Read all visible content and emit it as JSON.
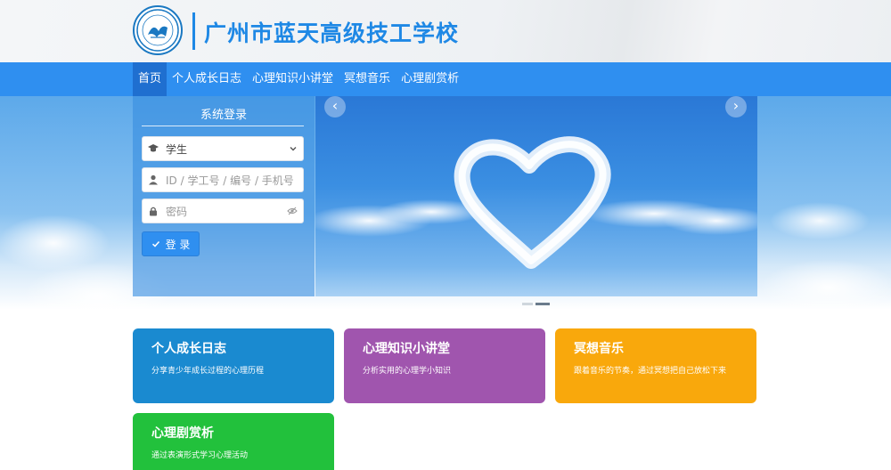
{
  "header": {
    "site_title": "广州市蓝天高级技工学校"
  },
  "nav": {
    "items": [
      {
        "label": "首页",
        "active": true
      },
      {
        "label": "个人成长日志",
        "active": false
      },
      {
        "label": "心理知识小讲堂",
        "active": false
      },
      {
        "label": "冥想音乐",
        "active": false
      },
      {
        "label": "心理剧赏析",
        "active": false
      }
    ]
  },
  "login": {
    "title": "系统登录",
    "role_value": "学生",
    "id_placeholder": "ID / 学工号 / 编号 / 手机号",
    "password_placeholder": "密码",
    "submit_label": "登 录"
  },
  "cards": [
    {
      "title": "个人成长日志",
      "desc": "分享青少年成长过程的心理历程",
      "color": "#1a8ad0"
    },
    {
      "title": "心理知识小讲堂",
      "desc": "分析实用的心理学小知识",
      "color": "#a055ae"
    },
    {
      "title": "冥想音乐",
      "desc": "跟着音乐的节奏，通过冥想把自己放松下来",
      "color": "#f9a80c"
    },
    {
      "title": "心理剧赏析",
      "desc": "通过表演形式学习心理活动",
      "color": "#22c13c"
    }
  ],
  "carousel": {
    "slide_count": 2,
    "active_slide": 2
  },
  "colors": {
    "brand": "#1e88e5",
    "nav_bg": "#2f8ff0",
    "nav_active": "#1f6fd0"
  }
}
